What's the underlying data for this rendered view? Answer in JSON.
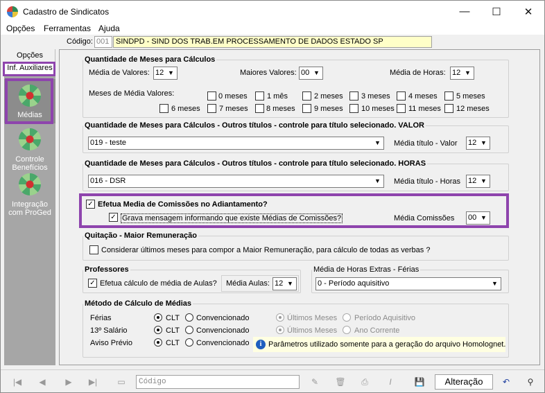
{
  "window": {
    "title": "Cadastro de Sindicatos",
    "minimize": "—",
    "maximize": "☐",
    "close": "✕"
  },
  "menu": [
    "Opções",
    "Ferramentas",
    "Ajuda"
  ],
  "code": {
    "label": "Código:",
    "value": "001",
    "name": "SINDPD - SIND DOS TRAB.EM PROCESSAMENTO DE DADOS ESTADO SP"
  },
  "left": {
    "tabs": [
      "Opções",
      "Inf. Auxiliares"
    ],
    "nav": [
      {
        "label": "Médias"
      },
      {
        "label": "Controle Benefícios"
      },
      {
        "label": "Integração com ProGed"
      }
    ]
  },
  "sec1": {
    "title": "Quantidade de Meses para Cálculos",
    "media_valores_label": "Média de Valores:",
    "media_valores": "12",
    "maiores_valores_label": "Maiores Valores:",
    "maiores_valores": "00",
    "media_horas_label": "Média de Horas:",
    "media_horas": "12",
    "meses_label": "Meses de Média Valores:",
    "meses_row1": [
      "0 meses",
      "1 mês",
      "2 meses",
      "3 meses",
      "4 meses",
      "5 meses"
    ],
    "meses_row2": [
      "6 meses",
      "7 meses",
      "8 meses",
      "9 meses",
      "10 meses",
      "11 meses",
      "12 meses"
    ]
  },
  "sec2": {
    "title": "Quantidade de Meses para Cálculos - Outros títulos - controle para título selecionado. VALOR",
    "selected": "019 - teste",
    "media_label": "Média título - Valor",
    "media_value": "12"
  },
  "sec3": {
    "title": "Quantidade de Meses para Cálculos - Outros títulos - controle para título selecionado. HORAS",
    "selected": "016 - DSR",
    "media_label": "Média título - Horas",
    "media_value": "12"
  },
  "sec4": {
    "title": "Efetua Media de Comissões no Adiantamento?",
    "check_label": "Grava mensagem informando que existe Médias de Comissões?",
    "media_label": "Média Comissões",
    "media_value": "00"
  },
  "sec5": {
    "title": "Quitação - Maior Remuneração",
    "check_label": "Considerar últimos meses para compor a Maior Remuneração, para cálculo de todas as verbas ?"
  },
  "sec6": {
    "title": "Professores",
    "check_label": "Efetua cálculo de média de Aulas?",
    "media_label": "Média Aulas:",
    "media_value": "12"
  },
  "sec7": {
    "title": "Média de Horas Extras - Férias",
    "selected": "0 - Período aquisitivo"
  },
  "sec8": {
    "title": "Método de Cálculo de Médias",
    "rows": [
      {
        "label": "Férias",
        "opt1": "CLT",
        "opt2": "Convencionado",
        "opt3": "Últimos Meses",
        "opt4": "Período Aquisitivo"
      },
      {
        "label": "13º Salário",
        "opt1": "CLT",
        "opt2": "Convencionado",
        "opt3": "Últimos Meses",
        "opt4": "Ano Corrente"
      },
      {
        "label": "Aviso Prévio",
        "opt1": "CLT",
        "opt2": "Convencionado"
      }
    ],
    "info": "Parâmetros utilizado somente para a geração do arquivo Homolognet."
  },
  "toolbar": {
    "code_placeholder": "Código",
    "status": "Alteração"
  }
}
